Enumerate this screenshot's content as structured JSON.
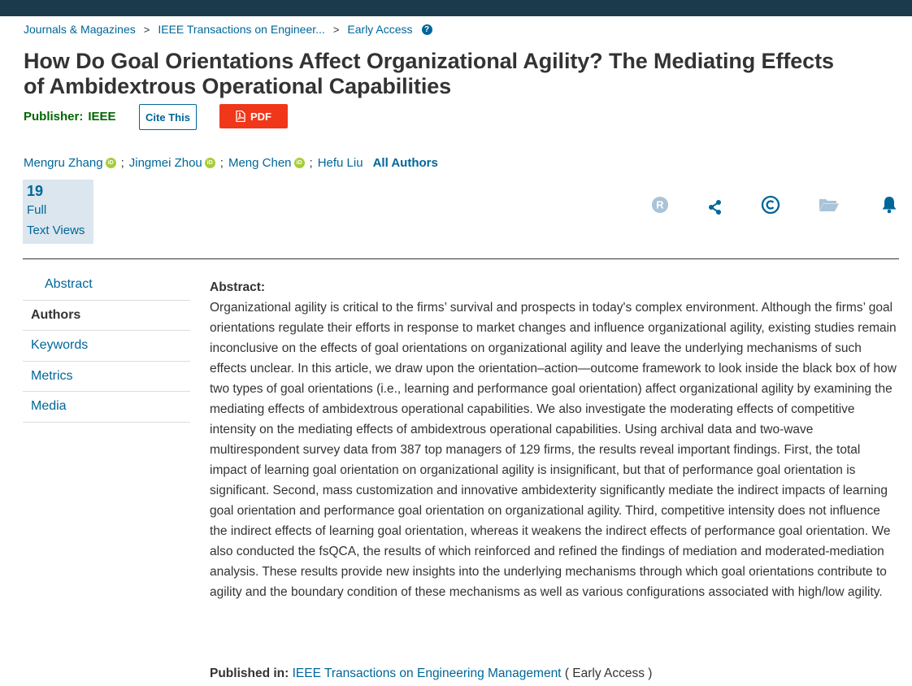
{
  "breadcrumb": {
    "item1": "Journals & Magazines",
    "item2": "IEEE Transactions on Engineer...",
    "item3": "Early Access",
    "sep": ">",
    "help": "?"
  },
  "title_line1": "How Do Goal Orientations Affect Organizational Agility? The Mediating Effects",
  "title_line2": "of Ambidextrous Operational Capabilities",
  "publisher": {
    "label": "Publisher:",
    "name": "IEEE"
  },
  "buttons": {
    "cite": "Cite This",
    "pdf": "PDF"
  },
  "authors": {
    "a1": "Mengru Zhang",
    "a2": "Jingmei Zhou",
    "a3": "Meng Chen",
    "a4": "Hefu Liu",
    "all": "All Authors",
    "sep": ";",
    "orcid": "iD"
  },
  "metrics": {
    "count": "19",
    "line1": "Full",
    "line2": "Text Views"
  },
  "toolbar_icons": [
    "rights-icon",
    "share-icon",
    "copyright-icon",
    "folder-icon",
    "alert-bell-icon"
  ],
  "colors": {
    "link": "#006699",
    "publisher": "#006600",
    "pdf": "#f0371a",
    "topbar": "#1b3a4b",
    "metrics_bg": "#dbe6ee"
  },
  "sidenav": {
    "abstract": "Abstract",
    "authors": "Authors",
    "keywords": "Keywords",
    "metrics": "Metrics",
    "media": "Media"
  },
  "abstract": {
    "heading": "Abstract:",
    "text": "Organizational agility is critical to the firms’ survival and prospects in today's complex environment. Although the firms’ goal orientations regulate their efforts in response to market changes and influence organizational agility, existing studies remain inconclusive on the effects of goal orientations on organizational agility and leave the underlying mechanisms of such effects unclear. In this article, we draw upon the orientation–action—outcome framework to look inside the black box of how two types of goal orientations (i.e., learning and performance goal orientation) affect organizational agility by examining the mediating effects of ambidextrous operational capabilities. We also investigate the moderating effects of competitive intensity on the mediating effects of ambidextrous operational capabilities. Using archival data and two-wave multirespondent survey data from 387 top managers of 129 firms, the results reveal important findings. First, the total impact of learning goal orientation on organizational agility is insignificant, but that of performance goal orientation is significant. Second, mass customization and innovative ambidexterity significantly mediate the indirect impacts of learning goal orientation and performance goal orientation on organizational agility. Third, competitive intensity does not influence the indirect effects of learning goal orientation, whereas it weakens the indirect effects of performance goal orientation. We also conducted the fsQCA, the results of which reinforced and refined the findings of mediation and moderated-mediation analysis. These results provide new insights into the underlying mechanisms through which goal orientations contribute to agility and the boundary condition of these mechanisms as well as various configurations associated with high/low agility."
  },
  "published_in": {
    "label": "Published in:",
    "journal": "IEEE Transactions on Engineering Management",
    "status": "( Early Access )"
  }
}
